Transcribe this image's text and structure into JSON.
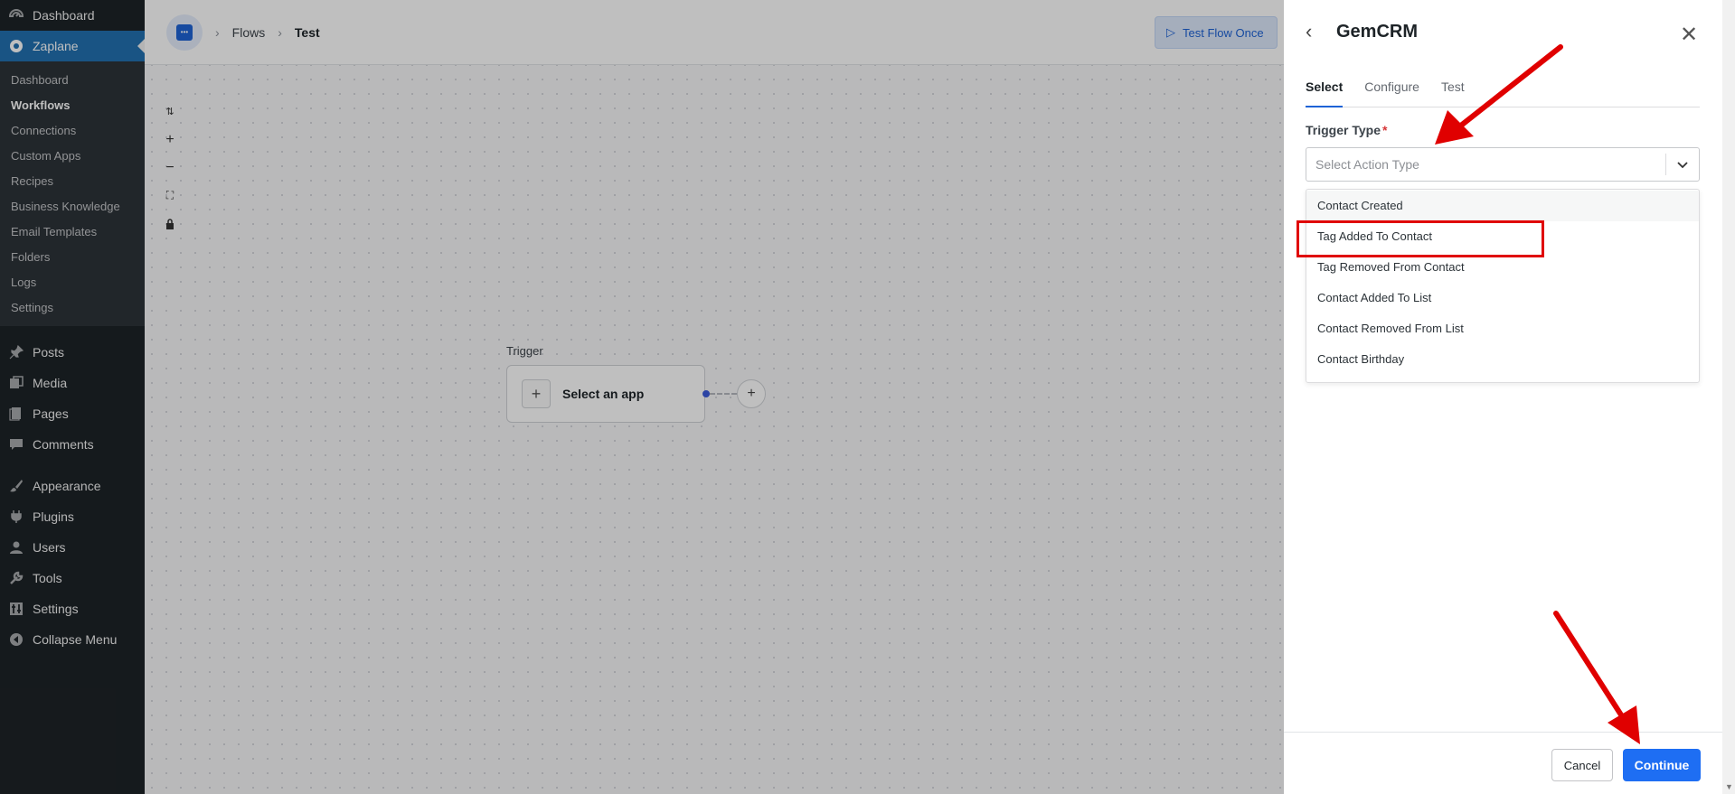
{
  "wp_menu": {
    "dashboard": "Dashboard",
    "zaplane": "Zaplane",
    "zaplane_sub": [
      "Dashboard",
      "Workflows",
      "Connections",
      "Custom Apps",
      "Recipes",
      "Business Knowledge",
      "Email Templates",
      "Folders",
      "Logs",
      "Settings"
    ],
    "posts": "Posts",
    "media": "Media",
    "pages": "Pages",
    "comments": "Comments",
    "appearance": "Appearance",
    "plugins": "Plugins",
    "users": "Users",
    "tools": "Tools",
    "settings": "Settings",
    "collapse": "Collapse Menu"
  },
  "topbar": {
    "breadcrumb": [
      "Flows",
      "Test"
    ],
    "test_flow_label": "Test Flow Once"
  },
  "canvas": {
    "trigger_label": "Trigger",
    "select_app_label": "Select an app"
  },
  "drawer": {
    "title": "GemCRM",
    "tabs": [
      "Select",
      "Configure",
      "Test"
    ],
    "active_tab": "Select",
    "field_label": "Trigger Type",
    "required_mark": "*",
    "select_placeholder": "Select Action Type",
    "options": [
      "Contact Created",
      "Tag Added To Contact",
      "Tag Removed From Contact",
      "Contact Added To List",
      "Contact Removed From List",
      "Contact Birthday"
    ],
    "highlighted_option": "Tag Added To Contact",
    "cancel_label": "Cancel",
    "continue_label": "Continue"
  },
  "colors": {
    "wp_sidebar": "#1d2327",
    "wp_current": "#2271b1",
    "primary": "#1e6ef3",
    "annotation": "#e00000"
  }
}
